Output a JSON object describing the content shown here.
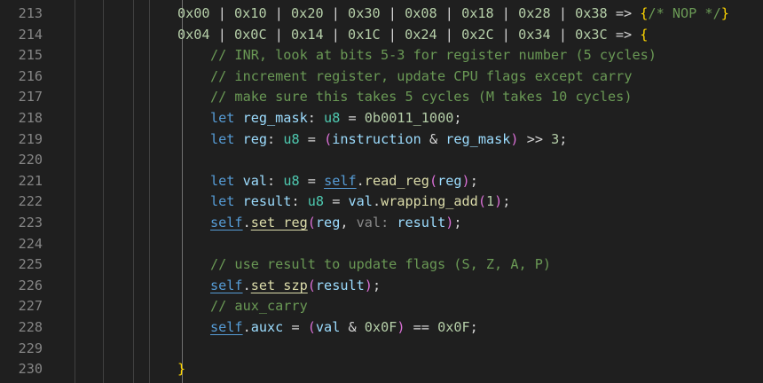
{
  "editor": {
    "language": "rust",
    "colors": {
      "background": "#1f1f1f",
      "line_number": "#858585",
      "number": "#b5cea8",
      "comment": "#6a9955",
      "keyword": "#569cd6",
      "variable": "#9cdcfe",
      "type": "#4ec9b0",
      "function": "#dcdcaa",
      "bracket_gold": "#ffd700",
      "bracket_purple": "#da70d6",
      "bracket_blue": "#179fff",
      "inlay_hint": "#8a8a8a"
    },
    "lines": [
      {
        "number": "213",
        "indent": 0,
        "tokens": [
          {
            "t": "0x00",
            "c": "num"
          },
          {
            "t": " | ",
            "c": "pun"
          },
          {
            "t": "0x10",
            "c": "num"
          },
          {
            "t": " | ",
            "c": "pun"
          },
          {
            "t": "0x20",
            "c": "num"
          },
          {
            "t": " | ",
            "c": "pun"
          },
          {
            "t": "0x30",
            "c": "num"
          },
          {
            "t": " | ",
            "c": "pun"
          },
          {
            "t": "0x08",
            "c": "num"
          },
          {
            "t": " | ",
            "c": "pun"
          },
          {
            "t": "0x18",
            "c": "num"
          },
          {
            "t": " | ",
            "c": "pun"
          },
          {
            "t": "0x28",
            "c": "num"
          },
          {
            "t": " | ",
            "c": "pun"
          },
          {
            "t": "0x38",
            "c": "num"
          },
          {
            "t": " => ",
            "c": "pun"
          },
          {
            "t": "{",
            "c": "br1"
          },
          {
            "t": "/* NOP */",
            "c": "com"
          },
          {
            "t": "}",
            "c": "br1"
          }
        ]
      },
      {
        "number": "214",
        "indent": 0,
        "tokens": [
          {
            "t": "0x04",
            "c": "num"
          },
          {
            "t": " | ",
            "c": "pun"
          },
          {
            "t": "0x0C",
            "c": "num"
          },
          {
            "t": " | ",
            "c": "pun"
          },
          {
            "t": "0x14",
            "c": "num"
          },
          {
            "t": " | ",
            "c": "pun"
          },
          {
            "t": "0x1C",
            "c": "num"
          },
          {
            "t": " | ",
            "c": "pun"
          },
          {
            "t": "0x24",
            "c": "num"
          },
          {
            "t": " | ",
            "c": "pun"
          },
          {
            "t": "0x2C",
            "c": "num"
          },
          {
            "t": " | ",
            "c": "pun"
          },
          {
            "t": "0x34",
            "c": "num"
          },
          {
            "t": " | ",
            "c": "pun"
          },
          {
            "t": "0x3C",
            "c": "num"
          },
          {
            "t": " => ",
            "c": "pun"
          },
          {
            "t": "{",
            "c": "br1"
          }
        ]
      },
      {
        "number": "215",
        "indent": 1,
        "tokens": [
          {
            "t": "// INR, look at bits 5-3 for register number (5 cycles)",
            "c": "com"
          }
        ]
      },
      {
        "number": "216",
        "indent": 1,
        "tokens": [
          {
            "t": "// increment register, update CPU flags except carry",
            "c": "com"
          }
        ]
      },
      {
        "number": "217",
        "indent": 1,
        "tokens": [
          {
            "t": "// make sure this takes 5 cycles (M takes 10 cycles)",
            "c": "com"
          }
        ]
      },
      {
        "number": "218",
        "indent": 1,
        "tokens": [
          {
            "t": "let",
            "c": "kw"
          },
          {
            "t": " ",
            "c": "pun"
          },
          {
            "t": "reg_mask",
            "c": "var"
          },
          {
            "t": ": ",
            "c": "pun"
          },
          {
            "t": "u8",
            "c": "typ"
          },
          {
            "t": " = ",
            "c": "pun"
          },
          {
            "t": "0b0011_1000",
            "c": "num"
          },
          {
            "t": ";",
            "c": "pun"
          }
        ]
      },
      {
        "number": "219",
        "indent": 1,
        "tokens": [
          {
            "t": "let",
            "c": "kw"
          },
          {
            "t": " ",
            "c": "pun"
          },
          {
            "t": "reg",
            "c": "var"
          },
          {
            "t": ": ",
            "c": "pun"
          },
          {
            "t": "u8",
            "c": "typ"
          },
          {
            "t": " = ",
            "c": "pun"
          },
          {
            "t": "(",
            "c": "br2"
          },
          {
            "t": "instruction",
            "c": "var"
          },
          {
            "t": " & ",
            "c": "pun"
          },
          {
            "t": "reg_mask",
            "c": "var"
          },
          {
            "t": ")",
            "c": "br2"
          },
          {
            "t": " >> ",
            "c": "pun"
          },
          {
            "t": "3",
            "c": "num"
          },
          {
            "t": ";",
            "c": "pun"
          }
        ]
      },
      {
        "number": "220",
        "indent": 1,
        "tokens": []
      },
      {
        "number": "221",
        "indent": 1,
        "tokens": [
          {
            "t": "let",
            "c": "kw"
          },
          {
            "t": " ",
            "c": "pun"
          },
          {
            "t": "val",
            "c": "var"
          },
          {
            "t": ": ",
            "c": "pun"
          },
          {
            "t": "u8",
            "c": "typ"
          },
          {
            "t": " = ",
            "c": "pun"
          },
          {
            "t": "self",
            "c": "kw",
            "u": true
          },
          {
            "t": ".",
            "c": "pun"
          },
          {
            "t": "read_reg",
            "c": "fn"
          },
          {
            "t": "(",
            "c": "br2"
          },
          {
            "t": "reg",
            "c": "var"
          },
          {
            "t": ")",
            "c": "br2"
          },
          {
            "t": ";",
            "c": "pun"
          }
        ]
      },
      {
        "number": "222",
        "indent": 1,
        "tokens": [
          {
            "t": "let",
            "c": "kw"
          },
          {
            "t": " ",
            "c": "pun"
          },
          {
            "t": "result",
            "c": "var"
          },
          {
            "t": ": ",
            "c": "pun"
          },
          {
            "t": "u8",
            "c": "typ"
          },
          {
            "t": " = ",
            "c": "pun"
          },
          {
            "t": "val",
            "c": "var"
          },
          {
            "t": ".",
            "c": "pun"
          },
          {
            "t": "wrapping_add",
            "c": "fn"
          },
          {
            "t": "(",
            "c": "br2"
          },
          {
            "t": "1",
            "c": "num"
          },
          {
            "t": ")",
            "c": "br2"
          },
          {
            "t": ";",
            "c": "pun"
          }
        ]
      },
      {
        "number": "223",
        "indent": 1,
        "tokens": [
          {
            "t": "self",
            "c": "kw",
            "u": true
          },
          {
            "t": ".",
            "c": "pun"
          },
          {
            "t": "set_reg",
            "c": "fn",
            "u": true
          },
          {
            "t": "(",
            "c": "br2"
          },
          {
            "t": "reg",
            "c": "var"
          },
          {
            "t": ", ",
            "c": "pun"
          },
          {
            "t": "val:",
            "c": "hint"
          },
          {
            "t": " ",
            "c": "pun"
          },
          {
            "t": "result",
            "c": "var"
          },
          {
            "t": ")",
            "c": "br2"
          },
          {
            "t": ";",
            "c": "pun"
          }
        ]
      },
      {
        "number": "224",
        "indent": 1,
        "tokens": []
      },
      {
        "number": "225",
        "indent": 1,
        "tokens": [
          {
            "t": "// use result to update flags (S, Z, A, P)",
            "c": "com"
          }
        ]
      },
      {
        "number": "226",
        "indent": 1,
        "tokens": [
          {
            "t": "self",
            "c": "kw",
            "u": true
          },
          {
            "t": ".",
            "c": "pun"
          },
          {
            "t": "set_szp",
            "c": "fn",
            "u": true
          },
          {
            "t": "(",
            "c": "br2"
          },
          {
            "t": "result",
            "c": "var"
          },
          {
            "t": ")",
            "c": "br2"
          },
          {
            "t": ";",
            "c": "pun"
          }
        ]
      },
      {
        "number": "227",
        "indent": 1,
        "tokens": [
          {
            "t": "// aux_carry",
            "c": "com"
          }
        ]
      },
      {
        "number": "228",
        "indent": 1,
        "tokens": [
          {
            "t": "self",
            "c": "kw",
            "u": true
          },
          {
            "t": ".",
            "c": "pun"
          },
          {
            "t": "auxc",
            "c": "var"
          },
          {
            "t": " = ",
            "c": "pun"
          },
          {
            "t": "(",
            "c": "br2"
          },
          {
            "t": "val",
            "c": "var"
          },
          {
            "t": " & ",
            "c": "pun"
          },
          {
            "t": "0x0F",
            "c": "num"
          },
          {
            "t": ")",
            "c": "br2"
          },
          {
            "t": " == ",
            "c": "pun"
          },
          {
            "t": "0x0F",
            "c": "num"
          },
          {
            "t": ";",
            "c": "pun"
          }
        ]
      },
      {
        "number": "229",
        "indent": 1,
        "tokens": []
      },
      {
        "number": "230",
        "indent": 0,
        "tokens": [
          {
            "t": "}",
            "c": "br1"
          }
        ]
      }
    ]
  }
}
